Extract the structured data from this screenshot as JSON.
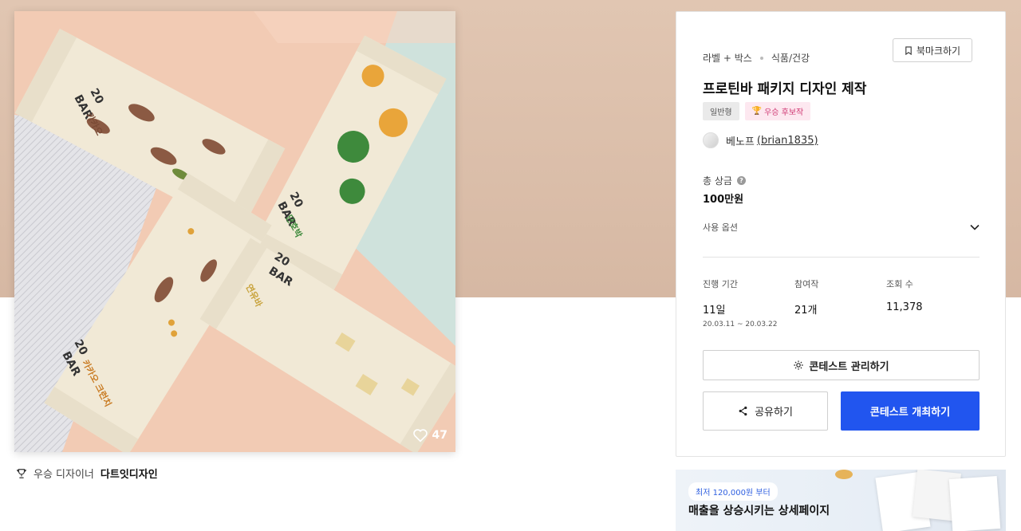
{
  "product_image": {
    "likes": "47",
    "bar_brand_line1": "20",
    "bar_brand_line2": "BAR",
    "flavor_cocoa": "카카오",
    "flavor_pumpkin": "단호박",
    "flavor_cocoa_crunch": "카카오 크런치",
    "flavor_milk": "연유바"
  },
  "winner": {
    "prefix": "우승 디자이너",
    "name": "다트잇디자인"
  },
  "panel": {
    "category1": "라벨 + 박스",
    "category2": "식품/건강",
    "bookmark_label": "북마크하기",
    "title": "프로틴바 패키지 디자인 제작",
    "badge_type": "일반형",
    "badge_winner": "우승 후보작",
    "host_name": "베노프",
    "host_handle": "(brian1835)",
    "prize_label": "총 상금",
    "prize_value": "100만원",
    "usage_label": "사용 옵션",
    "stats": [
      {
        "label": "진행 기간",
        "value": "11일",
        "sub": "20.03.11  ~  20.03.22"
      },
      {
        "label": "참여작",
        "value": "21개",
        "sub": ""
      },
      {
        "label": "조회 수",
        "value": "11,378",
        "sub": ""
      }
    ],
    "manage_button": "콘테스트 관리하기",
    "share_button": "공유하기",
    "host_button": "콘테스트 개최하기"
  },
  "ad": {
    "price_pill": "최저 120,000원 부터",
    "headline": "매출을 상승시키는 상세페이지"
  },
  "colors": {
    "primary": "#2155ef",
    "hero_bg": "#dcc0ab",
    "badge_pink": "#d03a74"
  }
}
